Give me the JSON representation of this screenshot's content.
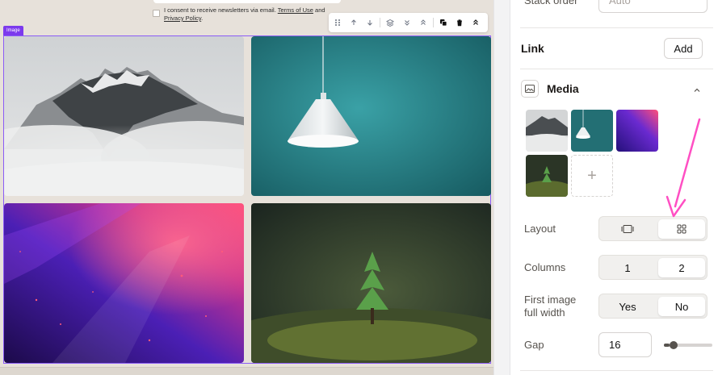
{
  "canvas": {
    "consent_text": "I consent to receive newsletters via email. ",
    "terms_link": "Terms of Use",
    "and_text": " and",
    "privacy_link": "Privacy Policy",
    "period": ".",
    "block_label": "Image",
    "toolbar": {
      "icons": [
        "drag-handle-icon",
        "arrow-up-icon",
        "arrow-down-icon",
        "layers-icon",
        "chevrons-down-icon",
        "chevrons-up-icon",
        "duplicate-icon",
        "trash-icon",
        "collapse-up-icon"
      ]
    },
    "images": [
      {
        "name": "misty-mountain-image",
        "colors": [
          "#d9dadb",
          "#6b6f72"
        ]
      },
      {
        "name": "pendant-lamp-image",
        "colors": [
          "#2f8d92",
          "#e8ecee"
        ]
      },
      {
        "name": "purple-nebula-image",
        "colors": [
          "#3a1a8f",
          "#ff3d8a"
        ]
      },
      {
        "name": "moss-sapling-image",
        "colors": [
          "#1f2a22",
          "#4c8a3a"
        ]
      }
    ]
  },
  "panel": {
    "stack_order_label": "Stack order",
    "stack_order_value": "Auto",
    "link_label": "Link",
    "link_add": "Add",
    "media_label": "Media",
    "add_media": "+",
    "layout_label": "Layout",
    "layout_options": [
      "carousel-icon",
      "grid-icon"
    ],
    "layout_selected": "grid-icon",
    "columns_label": "Columns",
    "columns_options": [
      "1",
      "2"
    ],
    "columns_selected": "2",
    "first_image_label_line1": "First image",
    "first_image_label_line2": "full width",
    "first_image_options": [
      "Yes",
      "No"
    ],
    "first_image_selected": "No",
    "gap_label": "Gap",
    "gap_value": "16",
    "gap_slider_fraction": 0.12,
    "annotation_arrow_color": "#ff4fc3"
  }
}
